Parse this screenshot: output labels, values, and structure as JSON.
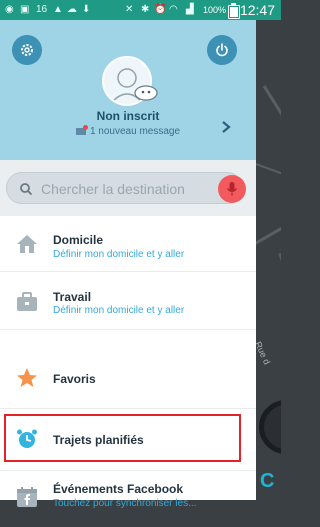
{
  "status_bar": {
    "battery_percent": "100%",
    "time": "12:47",
    "signal_label": "16"
  },
  "header": {
    "username": "Non inscrit",
    "message": "1 nouveau message"
  },
  "search": {
    "placeholder": "Chercher la destination"
  },
  "menu": {
    "items": [
      {
        "title": "Domicile",
        "subtitle": "Définir mon domicile et y aller",
        "icon": "home-icon"
      },
      {
        "title": "Travail",
        "subtitle": "Définir mon domicile et y aller",
        "icon": "briefcase-icon"
      },
      {
        "title": "Favoris",
        "subtitle": "",
        "icon": "star-icon"
      },
      {
        "title": "Trajets planifiés",
        "subtitle": "",
        "icon": "alarm-clock-icon"
      },
      {
        "title": "Événements Facebook",
        "subtitle": "Touchez pour synchroniser les...",
        "icon": "facebook-calendar-icon"
      }
    ]
  },
  "map": {
    "street_label": "Rue d"
  },
  "colors": {
    "status_bar": "#1f9a84",
    "header_bg": "#9fd4e6",
    "accent_blue": "#35a8d6",
    "mic_red": "#f25a5e",
    "highlight_red": "#e52228"
  }
}
